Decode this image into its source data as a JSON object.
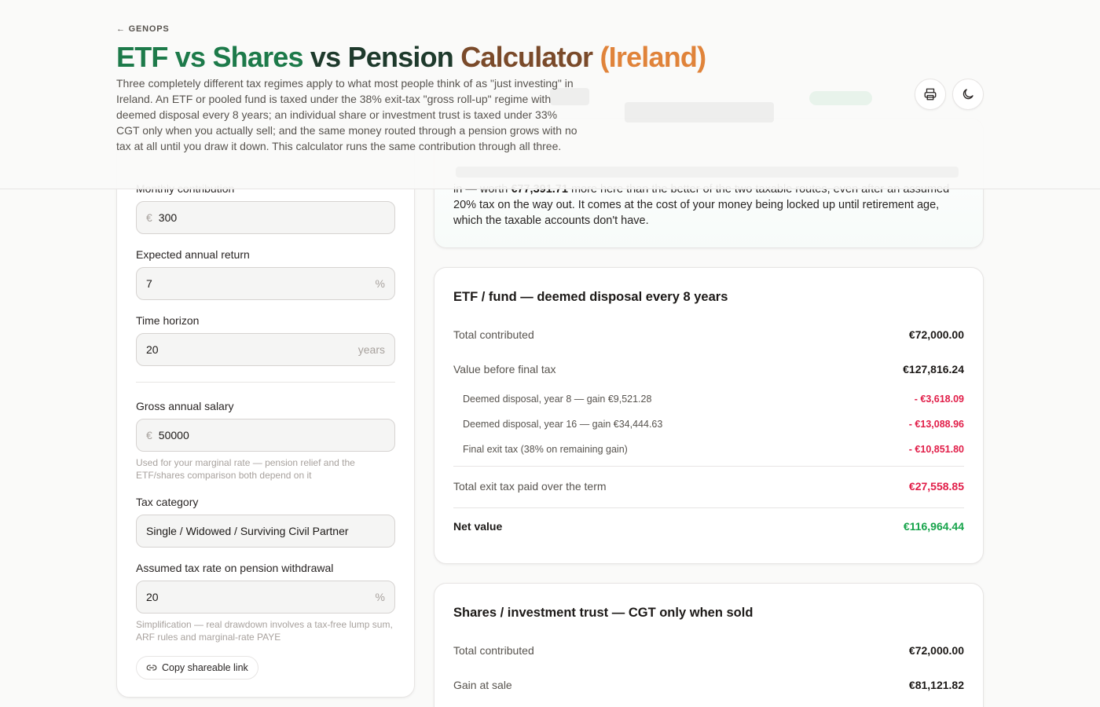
{
  "header": {
    "back_label": "← GENOPS",
    "title_part1": "ETF vs Shares",
    "title_part2": " vs Pension",
    "title_part3": " Calculator",
    "title_part4": " (Ireland)",
    "description": "Three completely different tax regimes apply to what most people think of as \"just investing\" in Ireland. An ETF or pooled fund is taxed under the 38% exit-tax \"gross roll-up\" regime with deemed disposal every 8 years; an individual share or investment trust is taxed under 33% CGT only when you actually sell; and the same money routed through a pension grows with no tax at all until you draw it down. This calculator runs the same contribution through all three.",
    "print_icon": "printer-icon",
    "theme_icon": "moon-icon"
  },
  "form": {
    "monthly_contribution": {
      "label": "Monthly contribution",
      "prefix": "€",
      "value": "300"
    },
    "annual_return": {
      "label": "Expected annual return",
      "value": "7",
      "suffix": "%"
    },
    "time_horizon": {
      "label": "Time horizon",
      "value": "20",
      "suffix": "years"
    },
    "salary": {
      "label": "Gross annual salary",
      "prefix": "€",
      "value": "50000",
      "hint": "Used for your marginal rate — pension relief and the ETF/shares comparison both depend on it"
    },
    "tax_category": {
      "label": "Tax category",
      "value": "Single / Widowed / Surviving Civil Partner"
    },
    "withdrawal_rate": {
      "label": "Assumed tax rate on pension withdrawal",
      "value": "20",
      "suffix": "%",
      "hint": "Simplification — real drawdown involves a tax-free lump sum, ARF rules and marginal-rate PAYE"
    },
    "copy_link_label": "Copy shareable link",
    "copy_link_icon": "link-icon"
  },
  "summary": {
    "text_before": "in — worth ",
    "highlight": "€77,391.71",
    "text_after": " more here than the better of the two taxable routes, even after an assumed 20% tax on the way out. It comes at the cost of your money being locked up until retirement age, which the taxable accounts don't have."
  },
  "etf_card": {
    "title": "ETF / fund — deemed disposal every 8 years",
    "rows": [
      {
        "label": "Total contributed",
        "amount": "€72,000.00"
      },
      {
        "label": "Value before final tax",
        "amount": "€127,816.24"
      }
    ],
    "sub_rows": [
      {
        "label": "Deemed disposal, year 8 — gain €9,521.28",
        "amount": "- €3,618.09"
      },
      {
        "label": "Deemed disposal, year 16 — gain €34,444.63",
        "amount": "- €13,088.96"
      },
      {
        "label": "Final exit tax (38% on remaining gain)",
        "amount": "- €10,851.80"
      }
    ],
    "total_tax": {
      "label": "Total exit tax paid over the term",
      "amount": "€27,558.85"
    },
    "net": {
      "label": "Net value",
      "amount": "€116,964.44"
    }
  },
  "shares_card": {
    "title": "Shares / investment trust — CGT only when sold",
    "rows": [
      {
        "label": "Total contributed",
        "amount": "€72,000.00"
      },
      {
        "label": "Gain at sale",
        "amount": "€81,121.82"
      }
    ]
  },
  "colors": {
    "accent_green": "#16a34a",
    "negative_red": "#e11d48",
    "title_green": "#1d7a4a",
    "title_orange": "#e0833a"
  }
}
